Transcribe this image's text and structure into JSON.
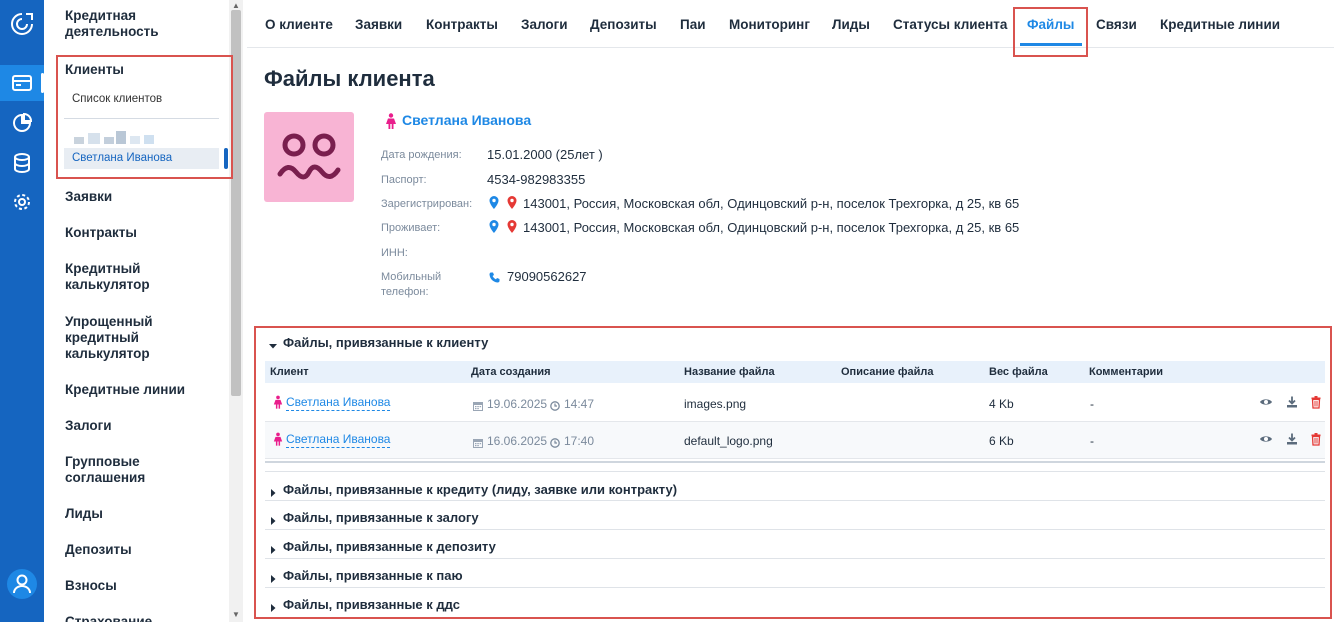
{
  "sidebar": {
    "sections": [
      {
        "label": "Кредитная деятельность"
      },
      {
        "label": "Клиенты"
      },
      {
        "label": "Заявки"
      },
      {
        "label": "Контракты"
      },
      {
        "label": "Кредитный калькулятор"
      },
      {
        "label": "Упрощенный кредитный калькулятор"
      },
      {
        "label": "Кредитные линии"
      },
      {
        "label": "Залоги"
      },
      {
        "label": "Групповые соглашения"
      },
      {
        "label": "Лиды"
      },
      {
        "label": "Депозиты"
      },
      {
        "label": "Взносы"
      },
      {
        "label": "Страхование"
      }
    ],
    "clients_list": "Список клиентов",
    "active_client": "Светлана Иванова"
  },
  "tabs": [
    {
      "label": "О клиенте"
    },
    {
      "label": "Заявки"
    },
    {
      "label": "Контракты"
    },
    {
      "label": "Залоги"
    },
    {
      "label": "Депозиты"
    },
    {
      "label": "Паи"
    },
    {
      "label": "Мониторинг"
    },
    {
      "label": "Лиды"
    },
    {
      "label": "Статусы клиента"
    },
    {
      "label": "Файлы"
    },
    {
      "label": "Связи"
    },
    {
      "label": "Кредитные линии"
    }
  ],
  "page": {
    "title": "Файлы клиента"
  },
  "client": {
    "name": "Светлана Иванова",
    "birth_label": "Дата рождения:",
    "birth_value": "15.01.2000 (25лет )",
    "passport_label": "Паспорт:",
    "passport_value": "4534-982983355",
    "registered_label": "Зарегистрирован:",
    "registered_value": "143001, Россия, Московская обл, Одинцовский р-н, поселок Трехгорка, д 25, кв 65",
    "lives_label": "Проживает:",
    "lives_value": "143001, Россия, Московская обл, Одинцовский р-н, поселок Трехгорка, д 25, кв 65",
    "inn_label": "ИНН:",
    "phone_label_1": "Мобильный",
    "phone_label_2": "телефон:",
    "phone_value": "79090562627"
  },
  "files": {
    "client_section": "Файлы, привязанные к клиенту",
    "columns": {
      "client": "Клиент",
      "created": "Дата создания",
      "name": "Название файла",
      "description": "Описание файла",
      "size": "Вес файла",
      "comments": "Комментарии"
    },
    "rows": [
      {
        "client": "Светлана Иванова",
        "date": "19.06.2025",
        "time": "14:47",
        "name": "images.png",
        "description": "",
        "size": "4 Kb",
        "comment": "-"
      },
      {
        "client": "Светлана Иванова",
        "date": "16.06.2025",
        "time": "17:40",
        "name": "default_logo.png",
        "description": "",
        "size": "6 Kb",
        "comment": "-"
      }
    ],
    "other_sections": [
      {
        "label": "Файлы, привязанные к кредиту (лиду, заявке или контракту)"
      },
      {
        "label": "Файлы, привязанные к залогу"
      },
      {
        "label": "Файлы, привязанные к депозиту"
      },
      {
        "label": "Файлы, привязанные к паю"
      },
      {
        "label": "Файлы, привязанные к ддс"
      }
    ]
  },
  "colors": {
    "rail": "#1565c0",
    "accent": "#1e88e5",
    "highlight": "#d9534f",
    "avatar_bg": "#f8b4d4",
    "avatar_fg": "#7a1f4e"
  }
}
